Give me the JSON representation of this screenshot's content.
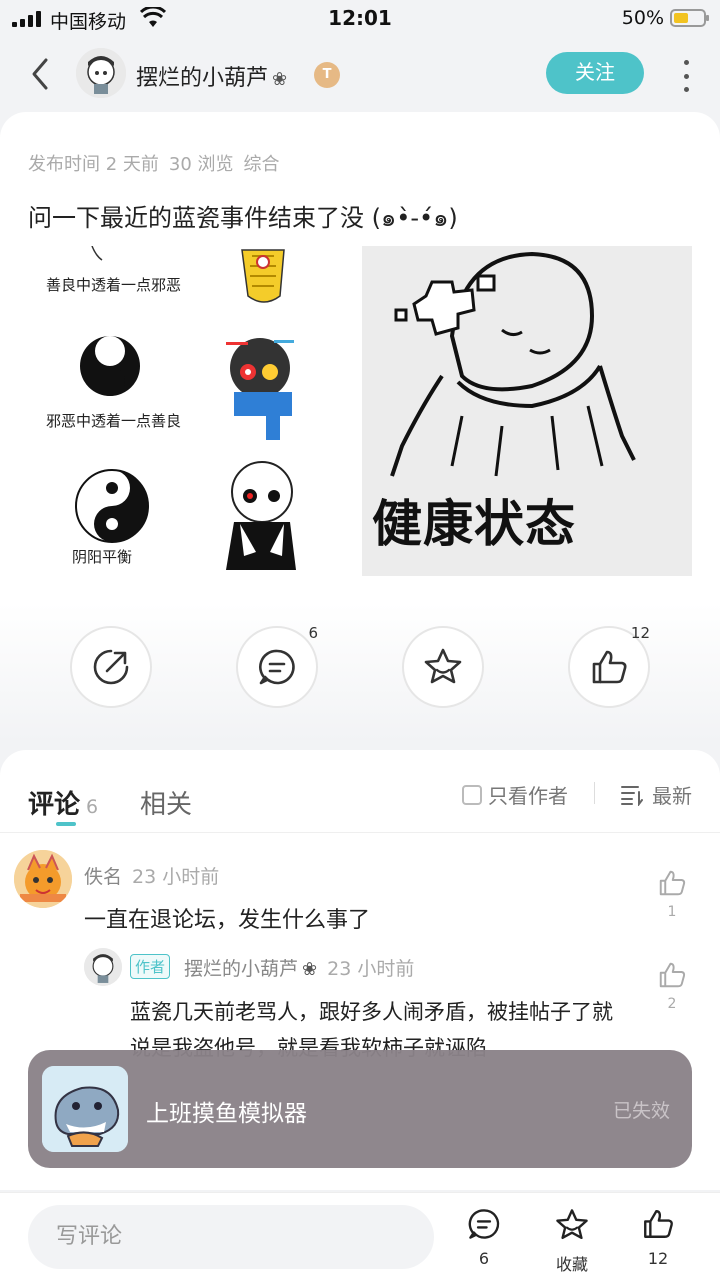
{
  "status_bar": {
    "carrier": "中国移动",
    "time": "12:01",
    "battery": "50%",
    "battery_level": 0.5
  },
  "header": {
    "username": "摆烂的小葫芦",
    "flower": "❀",
    "level_badge": "T",
    "follow_label": "关注",
    "icons": [
      "back-arrow-icon",
      "more-dots-icon"
    ]
  },
  "post": {
    "meta": [
      "发布时间 2 天前",
      "30 浏览",
      "综合"
    ],
    "title": "问一下最近的蓝瓷事件结束了没 (๑•̀-•́๑)",
    "image_left_labels": [
      "善良中透着一点邪恶",
      "邪恶中透着一点善良",
      "阴阳平衡"
    ],
    "image_right_text": "健康状态",
    "actions": [
      {
        "name": "share",
        "count": ""
      },
      {
        "name": "comment",
        "count": "6"
      },
      {
        "name": "collect",
        "count": ""
      },
      {
        "name": "like",
        "count": "12"
      }
    ]
  },
  "comments": {
    "tab_comment": "评论",
    "tab_comment_count": "6",
    "tab_related": "相关",
    "author_only": "只看作者",
    "sort": "最新",
    "items": [
      {
        "name": "佚名",
        "time": "23 小时前",
        "text": "一直在退论坛，发生什么事了",
        "likes": "1"
      }
    ],
    "reply": {
      "badge": "作者",
      "name": "摆烂的小葫芦",
      "flower": "❀",
      "time": "23 小时前",
      "text": "蓝瓷几天前老骂人，跟好多人闹矛盾，被挂帖子了就说是我盗他号，就是看我软柿子就诬陷",
      "likes": "2"
    }
  },
  "toast": {
    "title": "上班摸鱼模拟器",
    "status": "已失效"
  },
  "bottom_bar": {
    "placeholder": "写评论",
    "comment_count": "6",
    "collect_label": "收藏",
    "like_count": "12"
  }
}
